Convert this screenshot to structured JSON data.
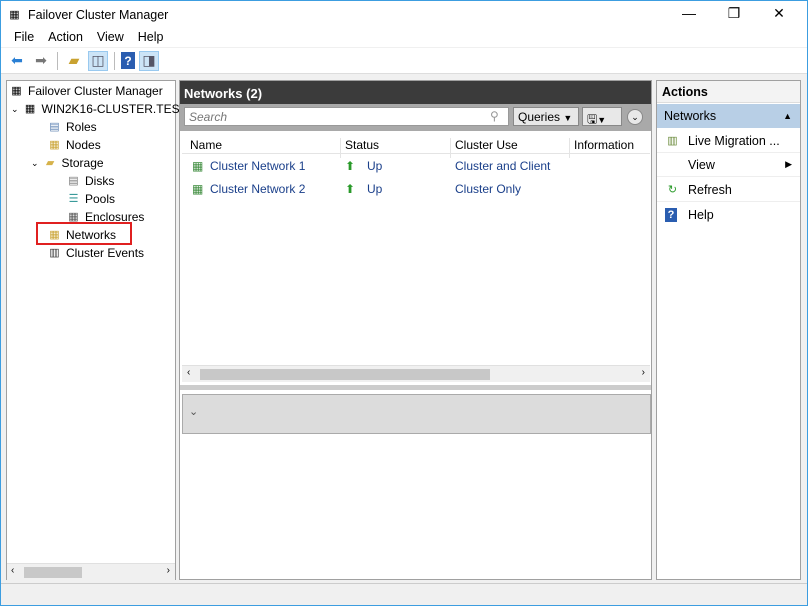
{
  "window": {
    "title": "Failover Cluster Manager",
    "minimize": "—",
    "maximize": "❐",
    "close": "✕"
  },
  "menu": [
    "File",
    "Action",
    "View",
    "Help"
  ],
  "tree": {
    "root": "Failover Cluster Manager",
    "cluster": "WIN2K16-CLUSTER.TES",
    "roles": "Roles",
    "nodes": "Nodes",
    "storage": "Storage",
    "disks": "Disks",
    "pools": "Pools",
    "enclosures": "Enclosures",
    "networks": "Networks",
    "events": "Cluster Events"
  },
  "main": {
    "title": "Networks (2)",
    "search_placeholder": "Search",
    "queries": "Queries",
    "columns": [
      "Name",
      "Status",
      "Cluster Use",
      "Information"
    ],
    "rows": [
      {
        "name": "Cluster Network 1",
        "status": "Up",
        "use": "Cluster and Client",
        "info": ""
      },
      {
        "name": "Cluster Network 2",
        "status": "Up",
        "use": "Cluster Only",
        "info": ""
      }
    ]
  },
  "actions": {
    "title": "Actions",
    "section": "Networks",
    "items": [
      "Live Migration ...",
      "View",
      "Refresh",
      "Help"
    ]
  }
}
